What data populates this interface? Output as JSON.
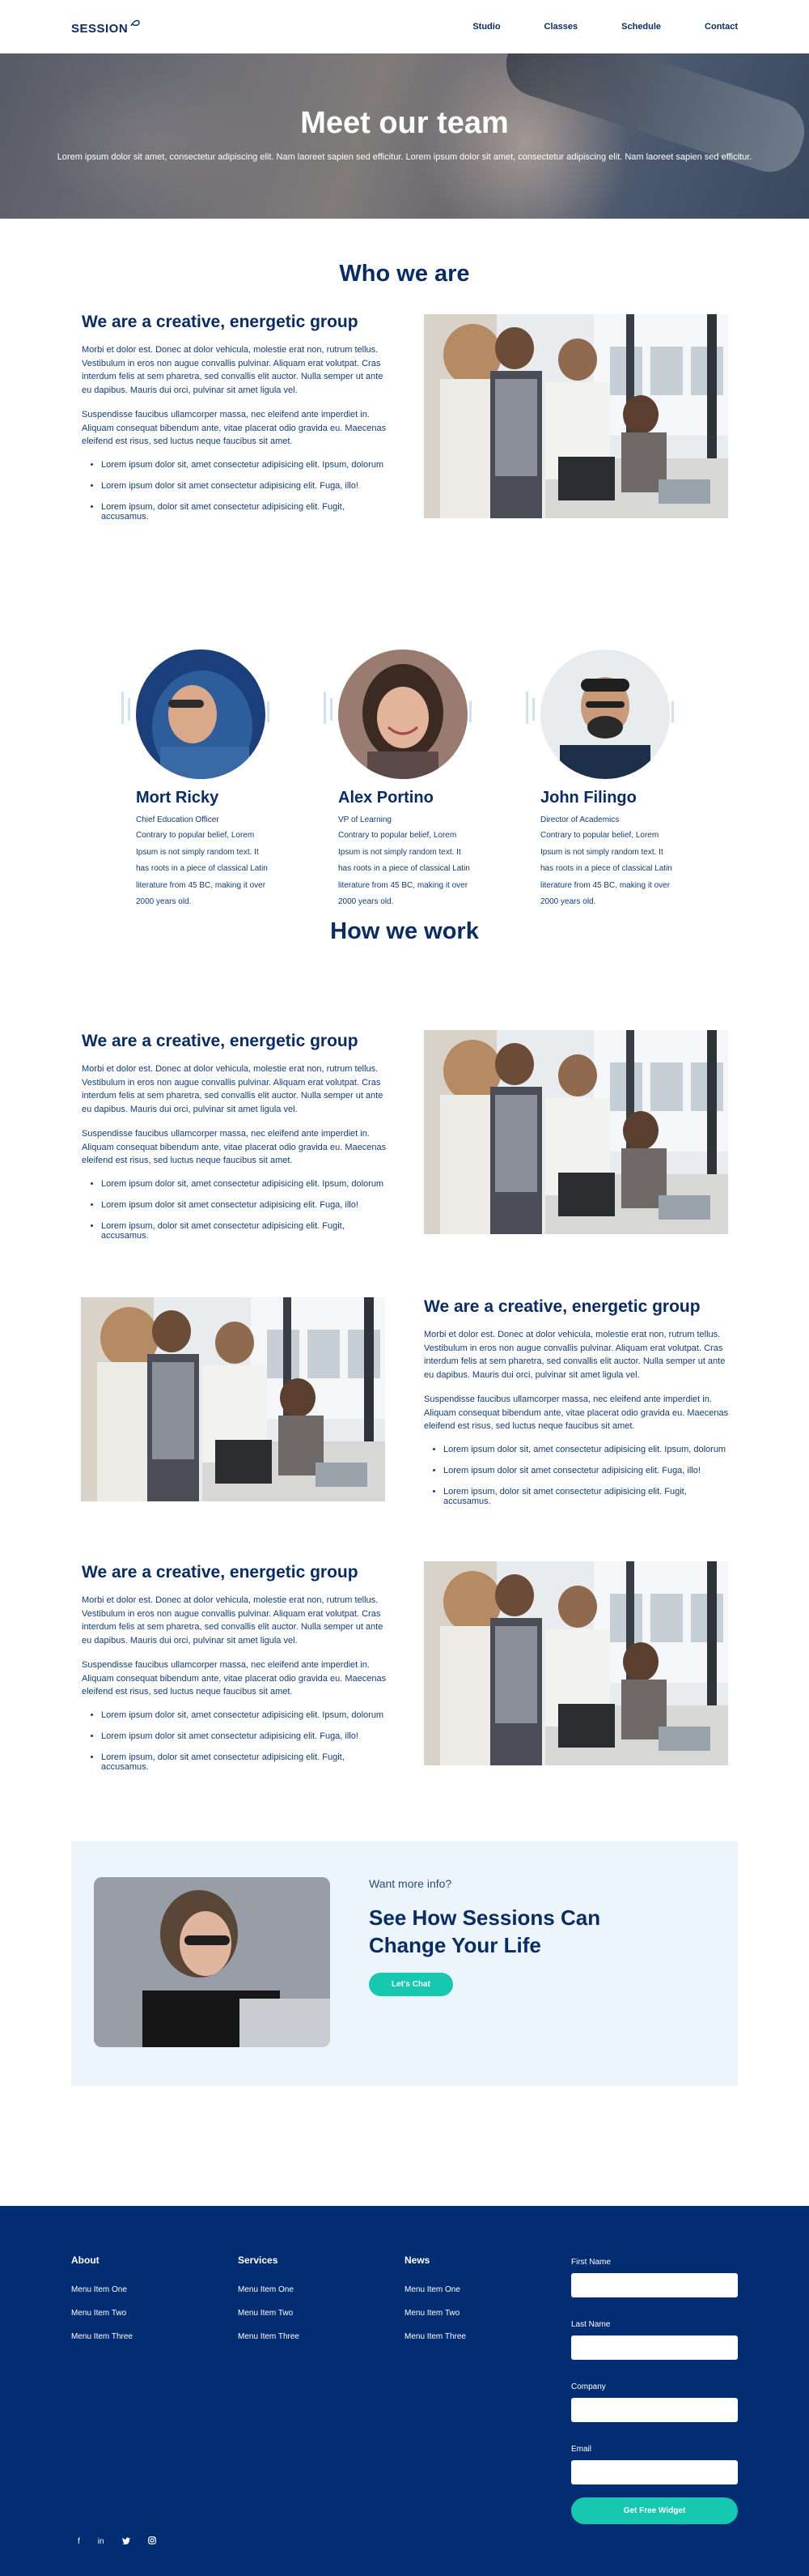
{
  "brand": {
    "logo_text": "SESSION"
  },
  "nav": {
    "items": [
      "Studio",
      "Classes",
      "Schedule",
      "Contact"
    ]
  },
  "hero": {
    "title": "Meet our team",
    "subtitle": "Lorem ipsum dolor sit amet, consectetur adipiscing elit. Nam laoreet sapien sed efficitur. Lorem ipsum dolor sit amet, consectetur adipiscing elit. Nam laoreet sapien sed efficitur."
  },
  "who": {
    "title": "Who we are",
    "heading": "We are a creative, energetic group",
    "para1": "Morbi et dolor est. Donec at dolor vehicula, molestie erat non, rutrum tellus. Vestibulum in eros non augue convallis pulvinar. Aliquam erat volutpat. Cras interdum felis at sem pharetra, sed convallis elit auctor. Nulla semper ut ante eu dapibus. Mauris dui orci, pulvinar sit amet ligula vel.",
    "para2": "Suspendisse faucibus ullamcorper massa, nec eleifend ante imperdiet in. Aliquam consequat bibendum ante, vitae placerat odio gravida eu. Maecenas eleifend est risus, sed luctus neque faucibus sit amet.",
    "bullets": [
      "Lorem ipsum dolor sit, amet consectetur adipisicing elit. Ipsum, dolorum",
      "Lorem ipsum dolor sit amet consectetur adipisicing elit. Fuga, illo!",
      "Lorem ipsum, dolor sit amet consectetur adipisicing elit. Fugit, accusamus."
    ]
  },
  "team": [
    {
      "name": "Mort Ricky",
      "role": "Chief Education Officer",
      "bio": "Contrary to popular belief, Lorem Ipsum is not simply random text. It has roots in a piece of classical Latin literature from 45 BC, making it over 2000 years old."
    },
    {
      "name": "Alex Portino",
      "role": "VP of Learning",
      "bio": "Contrary to popular belief, Lorem Ipsum is not simply random text. It has roots in a piece of classical Latin literature from 45 BC, making it over 2000 years old."
    },
    {
      "name": "John Filingo",
      "role": "Director of Academics",
      "bio": "Contrary to popular belief, Lorem Ipsum is not simply random text. It has roots in a piece of classical Latin literature from 45 BC, making it over 2000 years old."
    }
  ],
  "how": {
    "title": "How we work",
    "rows": [
      {
        "heading": "We are a creative, energetic group",
        "para1": "Morbi et dolor est. Donec at dolor vehicula, molestie erat non, rutrum tellus. Vestibulum in eros non augue convallis pulvinar. Aliquam erat volutpat. Cras interdum felis at sem pharetra, sed convallis elit auctor. Nulla semper ut ante eu dapibus. Mauris dui orci, pulvinar sit amet ligula vel.",
        "para2": "Suspendisse faucibus ullamcorper massa, nec eleifend ante imperdiet in. Aliquam consequat bibendum ante, vitae placerat odio gravida eu. Maecenas eleifend est risus, sed luctus neque faucibus sit amet.",
        "bullets": [
          "Lorem ipsum dolor sit, amet consectetur adipisicing elit. Ipsum, dolorum",
          "Lorem ipsum dolor sit amet consectetur adipisicing elit. Fuga, illo!",
          "Lorem ipsum, dolor sit amet consectetur adipisicing elit. Fugit, accusamus."
        ]
      },
      {
        "heading": "We are a creative, energetic group",
        "para1": "Morbi et dolor est. Donec at dolor vehicula, molestie erat non, rutrum tellus. Vestibulum in eros non augue convallis pulvinar. Aliquam erat volutpat. Cras interdum felis at sem pharetra, sed convallis elit auctor. Nulla semper ut ante eu dapibus. Mauris dui orci, pulvinar sit amet ligula vel.",
        "para2": "Suspendisse faucibus ullamcorper massa, nec eleifend ante imperdiet in. Aliquam consequat bibendum ante, vitae placerat odio gravida eu. Maecenas eleifend est risus, sed luctus neque faucibus sit amet.",
        "bullets": [
          "Lorem ipsum dolor sit, amet consectetur adipisicing elit. Ipsum, dolorum",
          "Lorem ipsum dolor sit amet consectetur adipisicing elit. Fuga, illo!",
          "Lorem ipsum, dolor sit amet consectetur adipisicing elit. Fugit, accusamus."
        ]
      },
      {
        "heading": "We are a creative, energetic group",
        "para1": "Morbi et dolor est. Donec at dolor vehicula, molestie erat non, rutrum tellus. Vestibulum in eros non augue convallis pulvinar. Aliquam erat volutpat. Cras interdum felis at sem pharetra, sed convallis elit auctor. Nulla semper ut ante eu dapibus. Mauris dui orci, pulvinar sit amet ligula vel.",
        "para2": "Suspendisse faucibus ullamcorper massa, nec eleifend ante imperdiet in. Aliquam consequat bibendum ante, vitae placerat odio gravida eu. Maecenas eleifend est risus, sed luctus neque faucibus sit amet.",
        "bullets": [
          "Lorem ipsum dolor sit, amet consectetur adipisicing elit. Ipsum, dolorum",
          "Lorem ipsum dolor sit amet consectetur adipisicing elit. Fuga, illo!",
          "Lorem ipsum, dolor sit amet consectetur adipisicing elit. Fugit, accusamus."
        ]
      }
    ]
  },
  "cta": {
    "pre": "Want more info?",
    "title": "See How Sessions Can Change Your Life",
    "button": "Let's Chat"
  },
  "footer": {
    "columns": [
      {
        "title": "About",
        "items": [
          "Menu Item One",
          "Menu Item Two",
          "Menu Item Three"
        ]
      },
      {
        "title": "Services",
        "items": [
          "Menu Item One",
          "Menu Item Two",
          "Menu Item Three"
        ]
      },
      {
        "title": "News",
        "items": [
          "Menu Item One",
          "Menu Item Two",
          "Menu Item Three"
        ]
      }
    ],
    "form": {
      "first_name": "First Name",
      "last_name": "Last Name",
      "company": "Company",
      "email": "Email",
      "button": "Get Free Widget"
    },
    "social": [
      "facebook-icon",
      "linkedin-icon",
      "twitter-icon",
      "instagram-icon"
    ]
  },
  "colors": {
    "navy": "#022d72",
    "teal": "#17c8b0",
    "light": "#edf5fc"
  }
}
